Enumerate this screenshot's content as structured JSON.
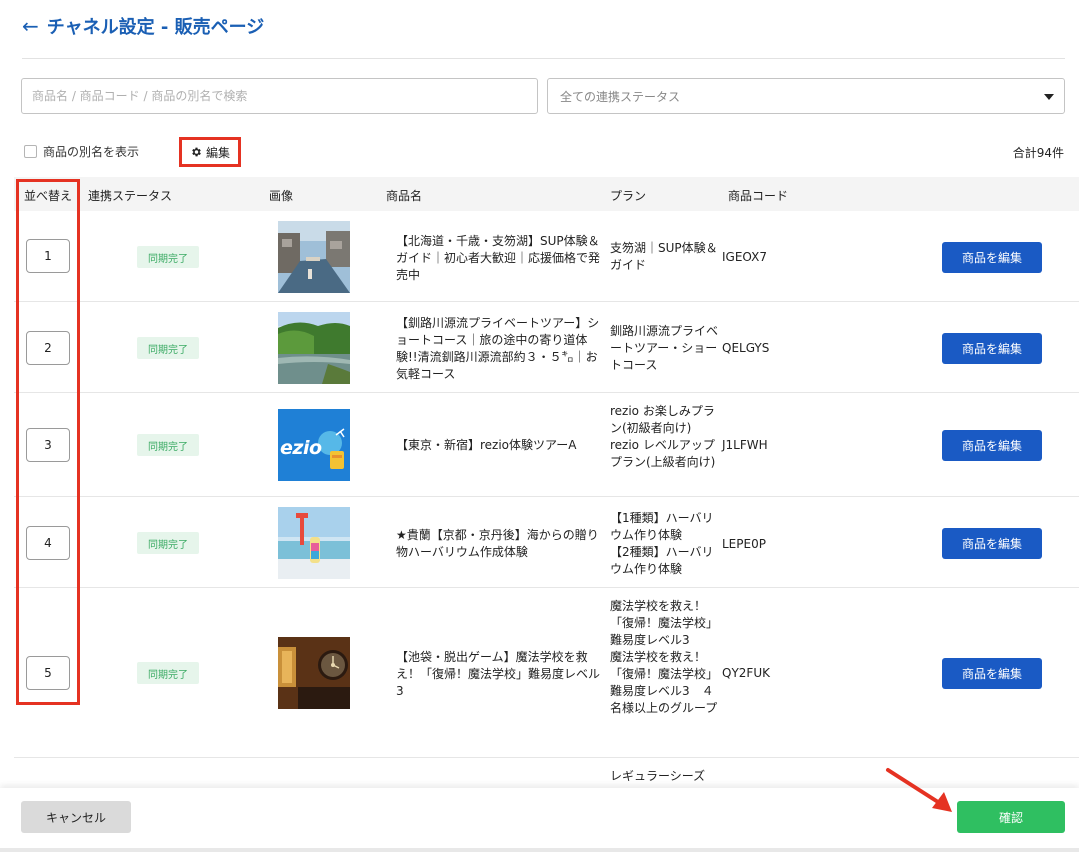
{
  "header": {
    "back_icon": "arrow-left-icon",
    "title": "チャネル設定 - 販売ページ"
  },
  "search": {
    "placeholder": "商品名 / 商品コード / 商品の別名で検索",
    "value": ""
  },
  "status_filter": {
    "selected": "全ての連携ステータス"
  },
  "options": {
    "alias_toggle_label": "商品の別名を表示",
    "alias_checked": false,
    "edit_label": "編集",
    "edit_icon": "gear-icon"
  },
  "total": "合計94件",
  "columns": {
    "sort": "並べ替え",
    "status": "連携ステータス",
    "image": "画像",
    "name": "商品名",
    "plan": "プラン",
    "code": "商品コード"
  },
  "rows": [
    {
      "order": "1",
      "status": "同期完了",
      "name": "【北海道・千歳・支笏湖】SUP体験＆ガイド｜初心者大歓迎｜応援価格で発売中",
      "plan": "支笏湖｜SUP体験＆ガイド",
      "code": "IGEOX7",
      "edit_label": "商品を編集"
    },
    {
      "order": "2",
      "status": "同期完了",
      "name": "【釧路川源流プライベートツアー】ショートコース｜旅の途中の寄り道体験!!清流釧路川源流部約３・５㌔｜お気軽コース",
      "plan": "釧路川源流プライベートツアー・ショートコース",
      "code": "QELGYS",
      "edit_label": "商品を編集"
    },
    {
      "order": "3",
      "status": "同期完了",
      "name": "【東京・新宿】rezio体験ツアーA",
      "plan": "rezio お楽しみプラン(初級者向け)\nrezio レベルアッププラン(上級者向け)",
      "code": "J1LFWH",
      "edit_label": "商品を編集",
      "thumb_text": "ezio"
    },
    {
      "order": "4",
      "status": "同期完了",
      "name": "★貴蘭【京都・京丹後】海からの贈り物ハーバリウム作成体験",
      "plan": "【1種類】ハーバリウム作り体験\n【2種類】ハーバリウム作り体験",
      "code": "LEPE0P",
      "edit_label": "商品を編集"
    },
    {
      "order": "5",
      "status": "同期完了",
      "name": "【池袋・脱出ゲーム】魔法学校を救え！「復帰！魔法学校」難易度レベル3",
      "plan": "魔法学校を救え！「復帰！魔法学校」難易度レベル3\n魔法学校を救え！「復帰！魔法学校」難易度レベル3　４名様以上のグループ",
      "code": "QY2FUK",
      "edit_label": "商品を編集"
    },
    {
      "plan": "レギュラーシーズ"
    }
  ],
  "footer": {
    "cancel_label": "キャンセル",
    "confirm_label": "確認"
  },
  "colors": {
    "primary": "#1a5ac4",
    "title": "#1a5fb4",
    "confirm": "#2fbf61",
    "badge_text": "#3aaa63",
    "badge_bg": "#e6f5eb",
    "highlight": "#e53222"
  }
}
